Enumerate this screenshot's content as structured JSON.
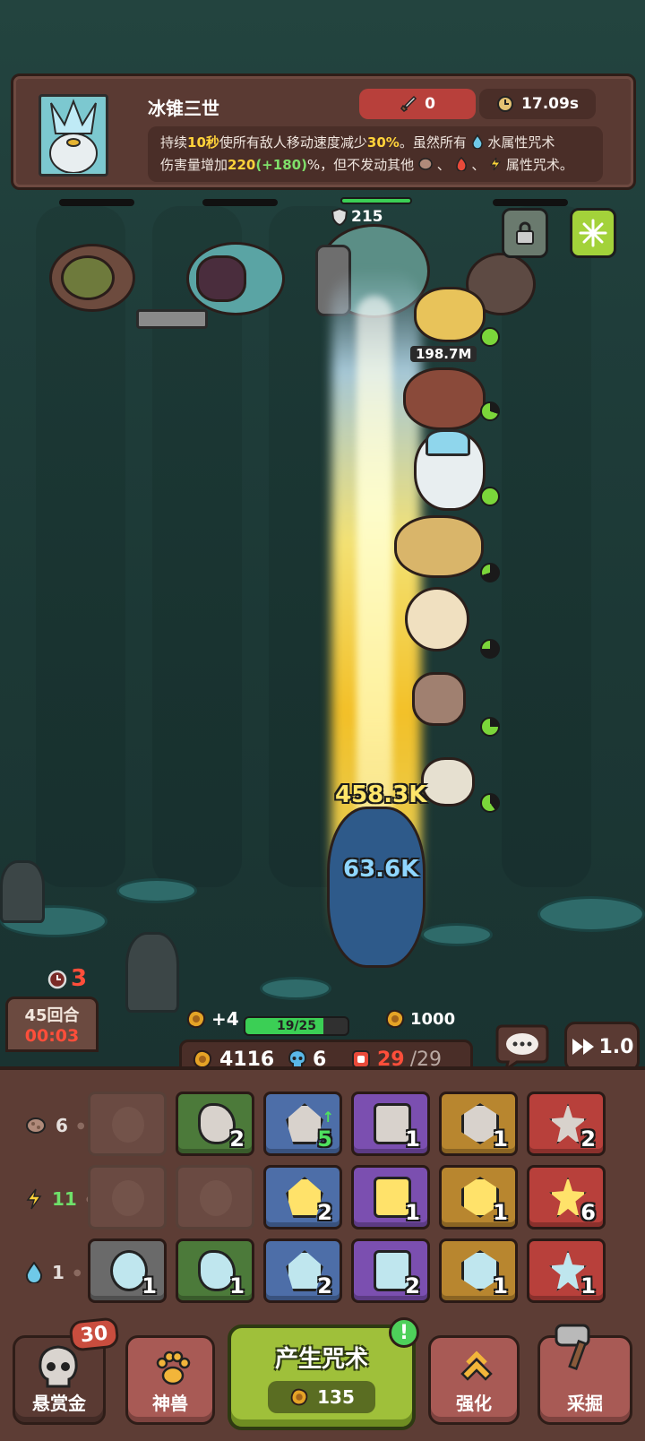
{
  "spell_panel": {
    "title": "冰锥三世",
    "attack_value": "0",
    "cooldown_value": "17.09s",
    "desc_line1_a": "持续",
    "desc_line1_b": "10秒",
    "desc_line1_c": "使所有敌人移动速度减少",
    "desc_line1_d": "30%",
    "desc_line1_e": "。虽然所有",
    "desc_line1_f": "水属性咒术",
    "desc_line2_a": "伤害量增加",
    "desc_line2_b": "220",
    "desc_line2_c": "(+180)",
    "desc_line2_d": "%，但不发动其他",
    "desc_line2_e": "、",
    "desc_line2_f": "、",
    "desc_line2_g": "属性咒术。"
  },
  "battle": {
    "boss_shield": "215",
    "hero_hp_label": "198.7M",
    "damage_numbers": [
      "458.3K",
      "63.6K"
    ],
    "timer_count": "3"
  },
  "hud": {
    "wave_label": "45回合",
    "wave_time": "00:03",
    "gold_gain": "+4",
    "xp_text": "19/25",
    "xp_progress": 0.76,
    "xp_target_value": "1000",
    "gold": "4116",
    "crystal": "6",
    "units_current": "29",
    "units_max": "/29",
    "speed": "1.0"
  },
  "spell_grid": {
    "rows": [
      {
        "element": "earth",
        "level": "6",
        "cards": [
          {
            "color": "empty",
            "count": ""
          },
          {
            "color": "#4c7a3a",
            "count": "2",
            "icon": "rock-spell-icon"
          },
          {
            "color": "#4d6ea8",
            "count": "5",
            "icon": "boulder-spell-icon",
            "upgrade": true
          },
          {
            "color": "#7b4fb0",
            "count": "1",
            "icon": "rock-shard-spell-icon"
          },
          {
            "color": "#b8862f",
            "count": "1",
            "icon": "spike-spell-icon"
          },
          {
            "color": "#b8403b",
            "count": "2",
            "icon": "eruption-spell-icon"
          }
        ]
      },
      {
        "element": "lightning",
        "level": "11",
        "cards": [
          {
            "color": "empty",
            "count": ""
          },
          {
            "color": "empty",
            "count": ""
          },
          {
            "color": "#4d6ea8",
            "count": "2",
            "icon": "spark-spell-icon"
          },
          {
            "color": "#7b4fb0",
            "count": "1",
            "icon": "burst-spell-icon"
          },
          {
            "color": "#b8862f",
            "count": "1",
            "icon": "lightning-orb-spell-icon"
          },
          {
            "color": "#b8403b",
            "count": "6",
            "icon": "thunder-star-spell-icon"
          }
        ]
      },
      {
        "element": "water",
        "level": "1",
        "cards": [
          {
            "color": "#6a6a6a",
            "count": "1",
            "icon": "raindrop-spell-icon"
          },
          {
            "color": "#4c7a3a",
            "count": "1",
            "icon": "ice-shard-spell-icon"
          },
          {
            "color": "#4d6ea8",
            "count": "2",
            "icon": "crystal-spell-icon"
          },
          {
            "color": "#7b4fb0",
            "count": "2",
            "icon": "snowflake-spell-icon"
          },
          {
            "color": "#b8862f",
            "count": "1",
            "icon": "ice-crown-spell-icon"
          },
          {
            "color": "#b8403b",
            "count": "1",
            "icon": "frost-star-spell-icon"
          }
        ]
      }
    ]
  },
  "nav": {
    "bounty_label": "悬赏金",
    "bounty_badge": "30",
    "beast_label": "神兽",
    "summon_label": "产生咒术",
    "summon_cost": "135",
    "summon_alert": "!",
    "upgrade_label": "强化",
    "mine_label": "采掘"
  },
  "colors": {
    "panel_bg": "#5a3a33",
    "attack_pill": "#b8403b",
    "main_button": "#9fc03a",
    "gold": "#e5a326",
    "hp_green": "#3bcf55"
  }
}
